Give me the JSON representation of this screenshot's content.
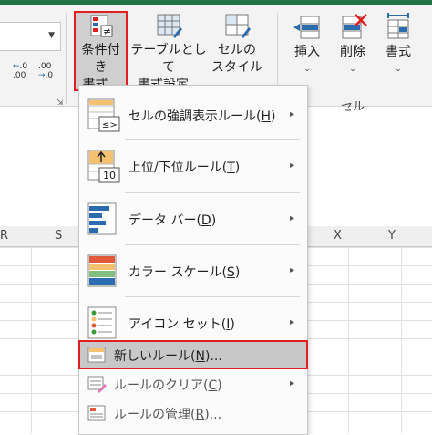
{
  "ribbon": {
    "decimal_increase": ".0\n.00",
    "decimal_decrease": ".00\n→.0",
    "conditional_formatting": {
      "line1": "条件付き",
      "line2": "書式"
    },
    "format_as_table": {
      "line1": "テーブルとして",
      "line2": "書式設定"
    },
    "cell_styles": {
      "line1": "セルの",
      "line2": "スタイル"
    },
    "insert": "挿入",
    "delete": "削除",
    "format": "書式",
    "group_cells": "セル",
    "chevron": "⌄",
    "launcher": "⇲"
  },
  "columns": {
    "r": "R",
    "s": "S",
    "x": "X",
    "y": "Y"
  },
  "menu": {
    "items": [
      {
        "label": "セルの強調表示ルール(",
        "key": "H",
        "tail": ")",
        "arrow": "▸"
      },
      {
        "label": "上位/下位ルール(",
        "key": "T",
        "tail": ")",
        "arrow": "▸"
      },
      {
        "label": "データ バー(",
        "key": "D",
        "tail": ")",
        "arrow": "▸"
      },
      {
        "label": "カラー スケール(",
        "key": "S",
        "tail": ")",
        "arrow": "▸"
      },
      {
        "label": "アイコン セット(",
        "key": "I",
        "tail": ")",
        "arrow": "▸"
      }
    ],
    "new_rule": {
      "label": "新しいルール(",
      "key": "N",
      "tail": ")..."
    },
    "clear_rules": {
      "label": "ルールのクリア(",
      "key": "C",
      "tail": ")",
      "arrow": "▸"
    },
    "manage_rules": {
      "label": "ルールの管理(",
      "key": "R",
      "tail": ")..."
    }
  },
  "icon_text": {
    "topbottom_num": "10",
    "cell_sym": "≤>"
  }
}
